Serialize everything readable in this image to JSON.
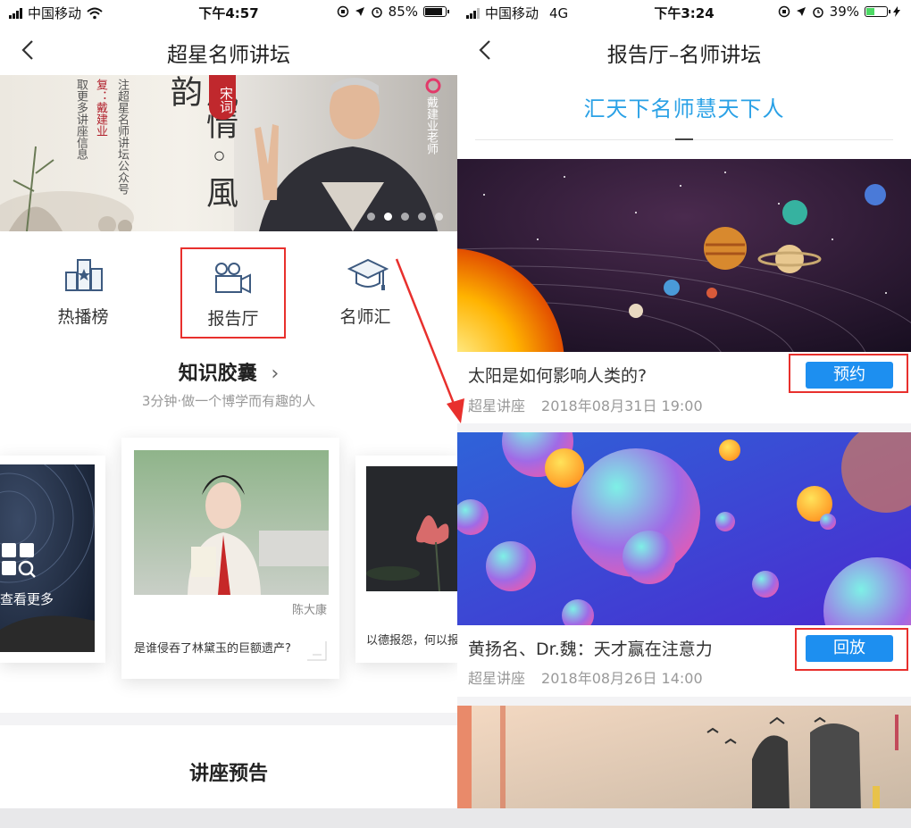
{
  "left": {
    "status": {
      "carrier": "中国移动",
      "time": "下午4:57",
      "battery": "85%"
    },
    "nav": {
      "title": "超星名师讲坛"
    },
    "banner": {
      "side_text_1": "取更多讲座信息",
      "side_text_2": "复：戴建业",
      "side_text_3": "注超星名师讲坛公众号",
      "big_text": "風情◦風韵",
      "seal": "宋词",
      "right_text": "戴建业老师"
    },
    "icons": [
      {
        "label": "热播榜",
        "icon": "trophy-icon"
      },
      {
        "label": "报告厅",
        "icon": "camera-icon"
      },
      {
        "label": "名师汇",
        "icon": "graduation-cap-icon"
      }
    ],
    "knowledge": {
      "title": "知识胶囊",
      "subtitle": "3分钟·做一个博学而有趣的人"
    },
    "cards": {
      "more_label": "查看更多",
      "center_author": "陈大康",
      "center_caption": "是谁侵吞了林黛玉的巨额遗产?",
      "right_caption": "以德报怨，何以报"
    },
    "preview_title": "讲座预告"
  },
  "right": {
    "status": {
      "carrier": "中国移动",
      "network": "4G",
      "time": "下午3:24",
      "battery": "39%"
    },
    "nav": {
      "title": "报告厅–名师讲坛"
    },
    "slogan": "汇天下名师慧天下人",
    "lectures": [
      {
        "title": "太阳是如何影响人类的?",
        "source": "超星讲座",
        "datetime": "2018年08月31日 19:00",
        "action": "预约"
      },
      {
        "title": "黄扬名、Dr.魏：天才赢在注意力",
        "source": "超星讲座",
        "datetime": "2018年08月26日 14:00",
        "action": "回放"
      }
    ]
  },
  "colors": {
    "accent_blue": "#1d8ff0",
    "slogan_blue": "#2aa1e6",
    "highlight_red": "#e8302d"
  }
}
